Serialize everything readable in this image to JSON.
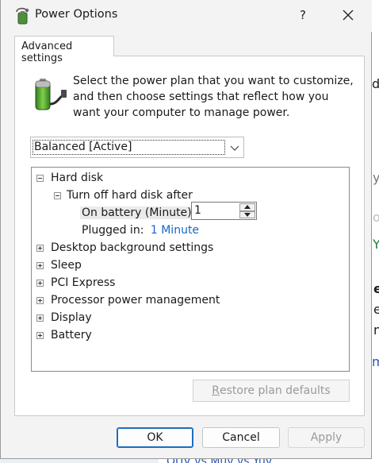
{
  "window": {
    "title": "Power Options",
    "help_label": "?",
    "close_label": "✕"
  },
  "tab": {
    "label": "Advanced settings"
  },
  "intro": {
    "text": "Select the power plan that you want to customize, and then choose settings that reflect how you want your computer to manage power."
  },
  "plan": {
    "selected": "Balanced [Active]"
  },
  "tree": {
    "hard_disk": {
      "label": "Hard disk",
      "turn_off": {
        "label": "Turn off hard disk after",
        "on_battery_label": "On battery (Minute):",
        "on_battery_value": "1",
        "plugged_in_label": "Plugged in:",
        "plugged_in_value": "1 Minute"
      }
    },
    "items": [
      {
        "label": "Desktop background settings"
      },
      {
        "label": "Sleep"
      },
      {
        "label": "PCI Express"
      },
      {
        "label": "Processor power management"
      },
      {
        "label": "Display"
      },
      {
        "label": "Battery"
      }
    ]
  },
  "buttons": {
    "restore_first": "R",
    "restore_rest": "estore plan defaults",
    "ok": "OK",
    "cancel": "Cancel",
    "apply": "Apply"
  },
  "background": {
    "bottom_text": "QUV vs Muv vs Yuv"
  },
  "colors": {
    "accent": "#1b6ec2",
    "link": "#1a66c6"
  }
}
